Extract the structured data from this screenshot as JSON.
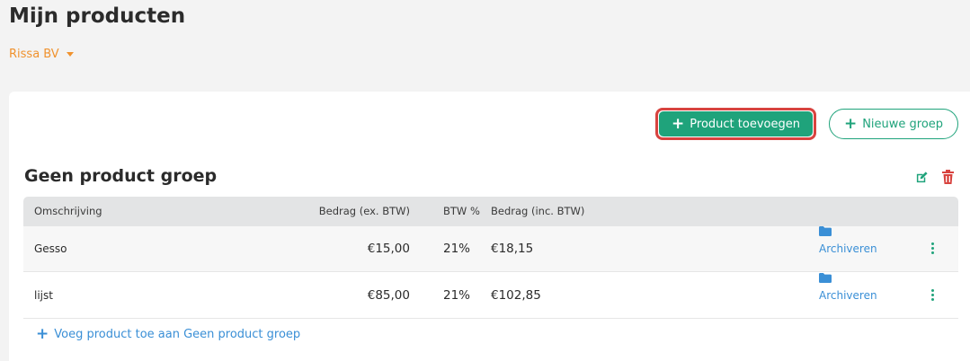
{
  "page": {
    "title": "Mijn producten"
  },
  "company": {
    "selected": "Rissa BV"
  },
  "toolbar": {
    "add_product_label": "Product toevoegen",
    "new_group_label": "Nieuwe groep"
  },
  "group": {
    "title": "Geen product groep",
    "columns": [
      "Omschrijving",
      "Bedrag (ex. BTW)",
      "BTW %",
      "Bedrag (inc. BTW)"
    ],
    "rows": [
      {
        "description": "Gesso",
        "amount_ex": "€15,00",
        "vat": "21%",
        "amount_inc": "€18,15",
        "archive_label": "Archiveren"
      },
      {
        "description": "lijst",
        "amount_ex": "€85,00",
        "vat": "21%",
        "amount_inc": "€102,85",
        "archive_label": "Archiveren"
      }
    ],
    "add_link_label": "Voeg product toe aan Geen product groep"
  },
  "colors": {
    "accent_green": "#1fa37b",
    "accent_orange": "#f0922e",
    "link_blue": "#3a8fd6",
    "danger_red": "#d8433f"
  }
}
